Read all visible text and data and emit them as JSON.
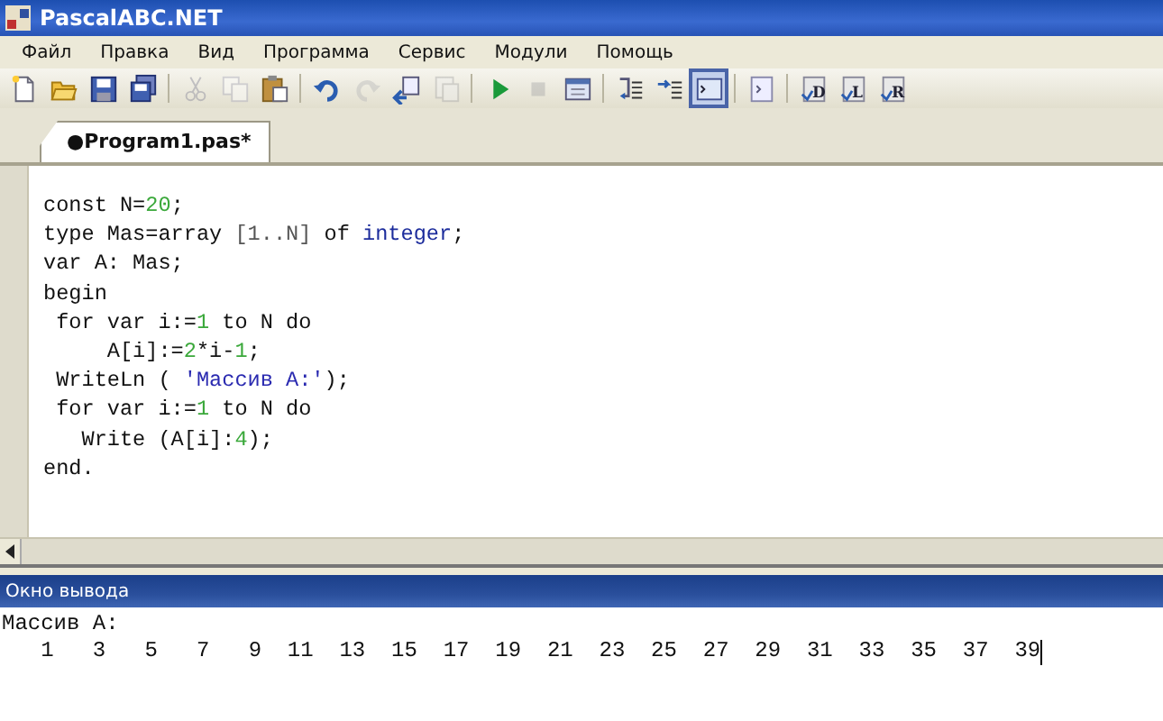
{
  "window": {
    "title": "PascalABC.NET"
  },
  "menu": [
    {
      "label": "Файл"
    },
    {
      "label": "Правка"
    },
    {
      "label": "Вид"
    },
    {
      "label": "Программа"
    },
    {
      "label": "Сервис"
    },
    {
      "label": "Модули"
    },
    {
      "label": "Помощь"
    }
  ],
  "toolbar": [
    {
      "kind": "new",
      "disabled": false,
      "pressed": false
    },
    {
      "kind": "open",
      "disabled": false,
      "pressed": false
    },
    {
      "kind": "save",
      "disabled": false,
      "pressed": false
    },
    {
      "kind": "saveall",
      "disabled": false,
      "pressed": false
    },
    {
      "kind": "sep"
    },
    {
      "kind": "cut",
      "disabled": true,
      "pressed": false
    },
    {
      "kind": "copy",
      "disabled": true,
      "pressed": false
    },
    {
      "kind": "paste",
      "disabled": false,
      "pressed": false
    },
    {
      "kind": "sep"
    },
    {
      "kind": "undo",
      "disabled": false,
      "pressed": false
    },
    {
      "kind": "redo",
      "disabled": true,
      "pressed": false
    },
    {
      "kind": "compile",
      "disabled": false,
      "pressed": false
    },
    {
      "kind": "build",
      "disabled": true,
      "pressed": false
    },
    {
      "kind": "sep"
    },
    {
      "kind": "run",
      "disabled": false,
      "pressed": false
    },
    {
      "kind": "stop",
      "disabled": true,
      "pressed": false
    },
    {
      "kind": "form",
      "disabled": false,
      "pressed": false
    },
    {
      "kind": "sep"
    },
    {
      "kind": "stepin",
      "disabled": false,
      "pressed": false
    },
    {
      "kind": "stepover",
      "disabled": false,
      "pressed": false
    },
    {
      "kind": "output",
      "disabled": false,
      "pressed": true
    },
    {
      "kind": "sep"
    },
    {
      "kind": "panel",
      "disabled": false,
      "pressed": false
    },
    {
      "kind": "sep"
    },
    {
      "kind": "letter",
      "letter": "D",
      "disabled": false,
      "pressed": false
    },
    {
      "kind": "letter",
      "letter": "L",
      "disabled": false,
      "pressed": false
    },
    {
      "kind": "letter",
      "letter": "R",
      "disabled": false,
      "pressed": false
    }
  ],
  "tabs": [
    {
      "label": "●Program1.pas*",
      "selected": true
    }
  ],
  "editor": {
    "lines": [
      [
        {
          "kind": "plain",
          "text": "const N="
        },
        {
          "kind": "number",
          "text": "20"
        },
        {
          "kind": "plain",
          "text": ";"
        }
      ],
      [
        {
          "kind": "plain",
          "text": "type Mas=array "
        },
        {
          "kind": "bracket",
          "text": "[1..N]"
        },
        {
          "kind": "plain",
          "text": " of "
        },
        {
          "kind": "type",
          "text": "integer"
        },
        {
          "kind": "plain",
          "text": ";"
        }
      ],
      [
        {
          "kind": "plain",
          "text": "var A: Mas;"
        }
      ],
      [
        {
          "kind": "plain",
          "text": "begin"
        }
      ],
      [
        {
          "kind": "plain",
          "text": " for var i:="
        },
        {
          "kind": "number",
          "text": "1"
        },
        {
          "kind": "plain",
          "text": " to N do"
        }
      ],
      [
        {
          "kind": "plain",
          "text": "     A[i]:="
        },
        {
          "kind": "number",
          "text": "2"
        },
        {
          "kind": "plain",
          "text": "*i-"
        },
        {
          "kind": "number",
          "text": "1"
        },
        {
          "kind": "plain",
          "text": ";"
        }
      ],
      [
        {
          "kind": "plain",
          "text": " WriteLn ( "
        },
        {
          "kind": "string",
          "text": "'Массив A:'"
        },
        {
          "kind": "plain",
          "text": ");"
        }
      ],
      [
        {
          "kind": "plain",
          "text": " for var i:="
        },
        {
          "kind": "number",
          "text": "1"
        },
        {
          "kind": "plain",
          "text": " to N do"
        }
      ],
      [
        {
          "kind": "plain",
          "text": "   Write (A[i]:"
        },
        {
          "kind": "number",
          "text": "4"
        },
        {
          "kind": "plain",
          "text": ");"
        }
      ],
      [
        {
          "kind": "plain",
          "text": "end."
        }
      ]
    ]
  },
  "output": {
    "title": "Окно вывода",
    "lines": [
      "Массив A:",
      "   1   3   5   7   9  11  13  15  17  19  21  23  25  27  29  31  33  35  37  39"
    ]
  }
}
